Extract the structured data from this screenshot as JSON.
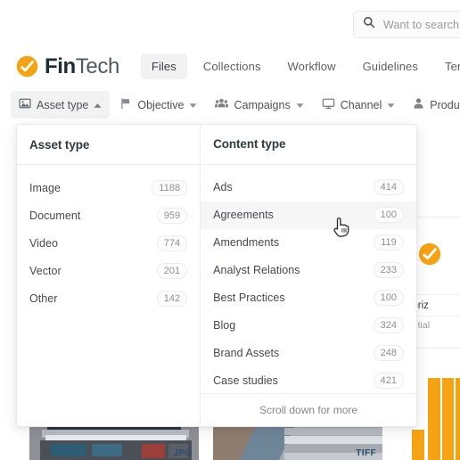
{
  "brand": {
    "name_part1": "Fin",
    "name_part2": "Tech",
    "logo_icon": "orange-circle-check-icon"
  },
  "search": {
    "icon": "search-icon",
    "placeholder": "Want to search",
    "value": ""
  },
  "nav": {
    "items": [
      {
        "label": "Files",
        "active": true
      },
      {
        "label": "Collections",
        "active": false
      },
      {
        "label": "Workflow",
        "active": false
      },
      {
        "label": "Guidelines",
        "active": false
      },
      {
        "label": "Ten",
        "active": false
      }
    ]
  },
  "filters": {
    "chips": [
      {
        "label": "Asset type",
        "icon": "image-icon",
        "caret": "up",
        "active": true
      },
      {
        "label": "Objective",
        "icon": "flag-icon",
        "caret": "down",
        "active": false
      },
      {
        "label": "Campaigns",
        "icon": "people-icon",
        "caret": "down",
        "active": false
      },
      {
        "label": "Channel",
        "icon": "monitor-icon",
        "caret": "down",
        "active": false
      },
      {
        "label": "Produced b",
        "icon": "person-icon",
        "caret": "none",
        "active": false
      }
    ]
  },
  "dropdown": {
    "asset_type": {
      "header": "Asset type",
      "items": [
        {
          "label": "Image",
          "count": "1188",
          "hover": false
        },
        {
          "label": "Document",
          "count": "959",
          "hover": false
        },
        {
          "label": "Video",
          "count": "774",
          "hover": false
        },
        {
          "label": "Vector",
          "count": "201",
          "hover": false
        },
        {
          "label": "Other",
          "count": "142",
          "hover": false
        }
      ]
    },
    "content_type": {
      "header": "Content type",
      "items": [
        {
          "label": "Ads",
          "count": "414",
          "hover": false
        },
        {
          "label": "Agreements",
          "count": "100",
          "hover": true
        },
        {
          "label": "Amendments",
          "count": "119",
          "hover": false
        },
        {
          "label": "Analyst Relations",
          "count": "233",
          "hover": false
        },
        {
          "label": "Best Practices",
          "count": "100",
          "hover": false
        },
        {
          "label": "Blog",
          "count": "324",
          "hover": false
        },
        {
          "label": "Brand Assets",
          "count": "248",
          "hover": false
        },
        {
          "label": "Case studies",
          "count": "421",
          "hover": false
        }
      ],
      "footer": "Scroll down for more"
    }
  },
  "background_card": {
    "logo_icon": "orange-circle-check-icon",
    "title": "go horiz",
    "subtitle": "nfidential"
  },
  "thumbnails": [
    {
      "badge": "JPG",
      "alt": "laptop-photo"
    },
    {
      "badge": "TIFF",
      "alt": "metal-pipes-photo"
    }
  ],
  "chart_bars": {
    "values": [
      34,
      92,
      92,
      92
    ],
    "color": "#f5a314"
  },
  "cursor": {
    "icon": "pointing-hand-cursor"
  },
  "colors": {
    "accent_orange": "#f5a314",
    "text_dark": "#2f3a41",
    "text_muted": "#8c9095",
    "panel_border": "#e9e9eb",
    "hover_bg": "#f6f6f7"
  }
}
